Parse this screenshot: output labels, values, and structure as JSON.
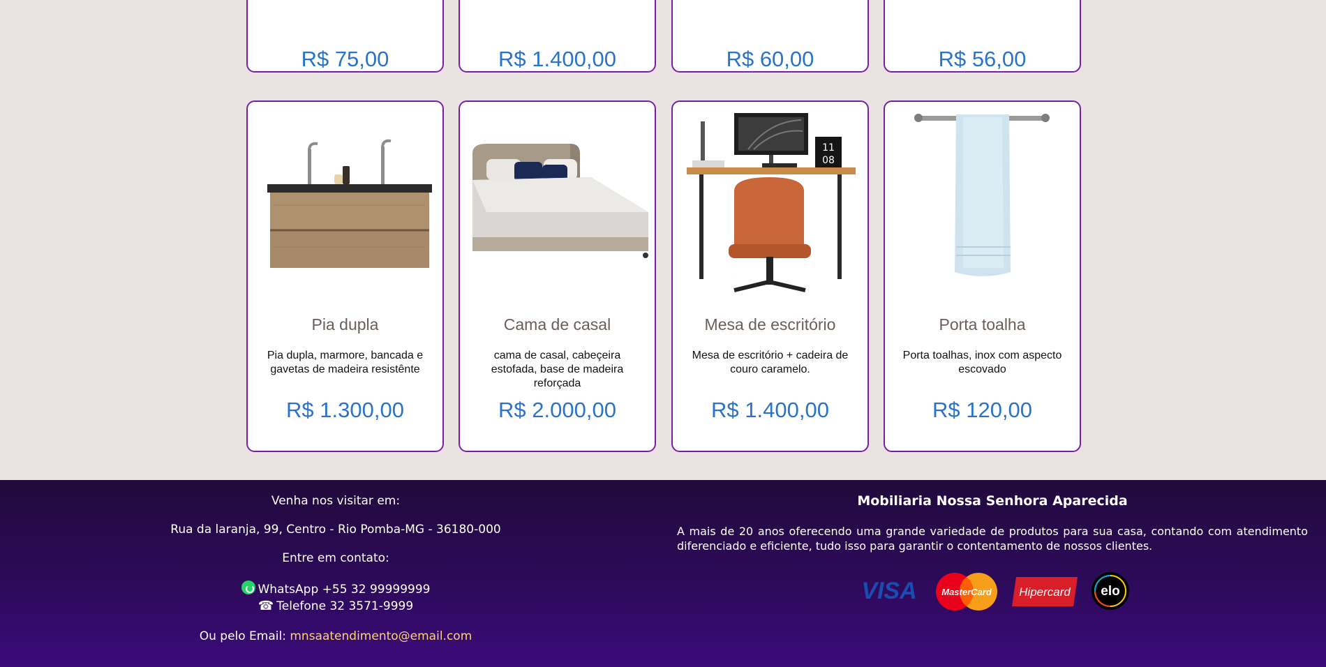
{
  "products_row1": [
    {
      "price": "R$ 75,00"
    },
    {
      "price": "R$ 1.400,00"
    },
    {
      "price": "R$ 60,00"
    },
    {
      "price": "R$ 56,00"
    }
  ],
  "products_row2": [
    {
      "name": "Pia dupla",
      "description": "Pia dupla, marmore, bancada e gavetas de madeira resistênte",
      "price": "R$ 1.300,00",
      "image": "double-sink-cabinet"
    },
    {
      "name": "Cama de casal",
      "description": "cama de casal, cabeçeira estofada, base de madeira reforçada",
      "price": "R$ 2.000,00",
      "image": "double-bed"
    },
    {
      "name": "Mesa de escritório",
      "description": "Mesa de escritório + cadeira de couro caramelo.",
      "price": "R$ 1.400,00",
      "image": "office-desk-chair"
    },
    {
      "name": "Porta toalha",
      "description": "Porta toalhas, inox com aspecto escovado",
      "price": "R$ 120,00",
      "image": "towel-rack"
    }
  ],
  "footer": {
    "visit_label": "Venha nos visitar em:",
    "address": "Rua da laranja, 99, Centro - Rio Pomba-MG - 36180-000",
    "contact_label": "Entre em contato:",
    "whatsapp": "WhatsApp +55 32 99999999",
    "phone": "Telefone 32 3571-9999",
    "email_label": "Ou pelo Email:",
    "email": "mnsaatendimento@email.com",
    "company_title": "Mobiliaria Nossa Senhora Aparecida",
    "about": "A mais de 20 anos oferecendo uma grande variedade de produtos para sua casa, contando com atendimento diferenciado e eficiente, tudo isso para garantir o contentamento de nossos clientes.",
    "payment_icons": [
      "visa-logo",
      "mastercard-logo",
      "hipercard-logo",
      "elo-logo"
    ],
    "payment_labels": {
      "visa": "VISA",
      "mastercard": "MasterCard",
      "hipercard": "Hipercard",
      "elo": "elo"
    }
  },
  "colors": {
    "price": "#2a73c8",
    "card_border": "#7a1fa2",
    "footer_bg": "#2d0a5a",
    "email_link": "#ffd27a"
  }
}
